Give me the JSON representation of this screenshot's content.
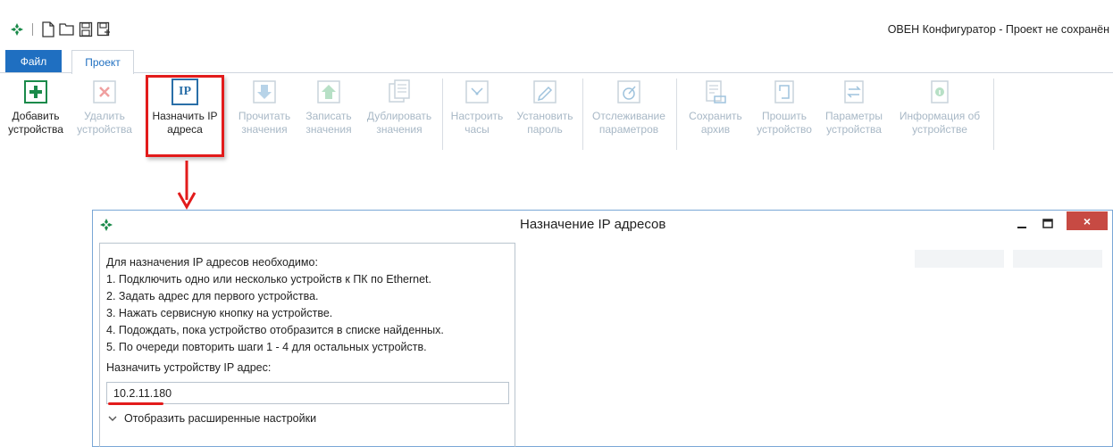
{
  "app": {
    "title": "ОВЕН Конфигуратор - Проект не сохранён"
  },
  "tabs": {
    "file": "Файл",
    "project": "Проект"
  },
  "ribbon": {
    "add": "Добавить\nустройства",
    "remove": "Удалить\nустройства",
    "assign_ip": "Назначить IP\nадреса",
    "read": "Прочитать\nзначения",
    "write": "Записать\nзначения",
    "duplicate": "Дублировать\nзначения",
    "clock": "Настроить\nчасы",
    "password": "Установить\nпароль",
    "monitor": "Отслеживание\nпараметров",
    "archive": "Сохранить\nархив",
    "firmware": "Прошить\nустройство",
    "params": "Параметры\nустройства",
    "info": "Информация об\nустройстве",
    "assign_ip_icon_text": "IP"
  },
  "dialog": {
    "title": "Назначение IP адресов",
    "close": "×",
    "instructions": [
      "Для назначения IP адресов необходимо:",
      "1. Подключить одно или несколько устройств к ПК по Ethernet.",
      "2. Задать адрес для первого устройства.",
      "3. Нажать сервисную кнопку на устройстве.",
      "4. Подождать, пока устройство отобразится в списке найденных.",
      "5. По очереди повторить шаги 1 - 4 для остальных устройств."
    ],
    "ip_label": "Назначить устройству IP адрес:",
    "ip_value": "10.2.11.180",
    "advanced": "Отобразить расширенные настройки"
  },
  "colors": {
    "accent": "#1f6fc1",
    "highlight": "#e21b1b",
    "close": "#c74a43",
    "disabled": "#a8b8c6"
  }
}
